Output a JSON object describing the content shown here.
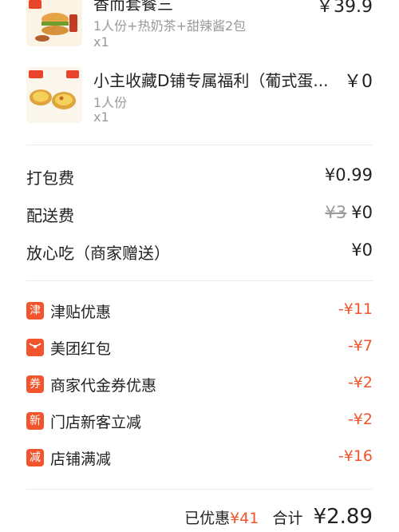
{
  "items": [
    {
      "name": "香而套餐三",
      "spec": "1人份+热奶茶+甜辣酱2包",
      "qty": "x1",
      "price": "￥39.9"
    },
    {
      "name": "小主收藏D铺专属福利（葡式蛋...",
      "spec": "1人份",
      "qty": "x1",
      "price": "￥0"
    }
  ],
  "fees": [
    {
      "label": "打包费",
      "value": "¥0.99",
      "original": ""
    },
    {
      "label": "配送费",
      "value": "¥0",
      "original": "¥3"
    },
    {
      "label": "放心吃（商家赠送）",
      "value": "¥0",
      "original": ""
    }
  ],
  "discounts": [
    {
      "badge": "津",
      "label": "津贴优惠",
      "amount": "-¥11",
      "icon": "allowance-icon"
    },
    {
      "badge": "",
      "label": "美团红包",
      "amount": "-¥7",
      "icon": "red-packet-icon"
    },
    {
      "badge": "券",
      "label": "商家代金券优惠",
      "amount": "-¥2",
      "icon": "coupon-icon"
    },
    {
      "badge": "新",
      "label": "门店新客立减",
      "amount": "-¥2",
      "icon": "new-customer-icon"
    },
    {
      "badge": "减",
      "label": "店铺满减",
      "amount": "-¥16",
      "icon": "full-reduction-icon"
    }
  ],
  "summary": {
    "saved_label": "已优惠",
    "saved_amount": "¥41",
    "total_label": "合计",
    "total_amount": "¥2.89"
  },
  "colors": {
    "accent": "#f2542d",
    "muted": "#9a9a9a"
  }
}
